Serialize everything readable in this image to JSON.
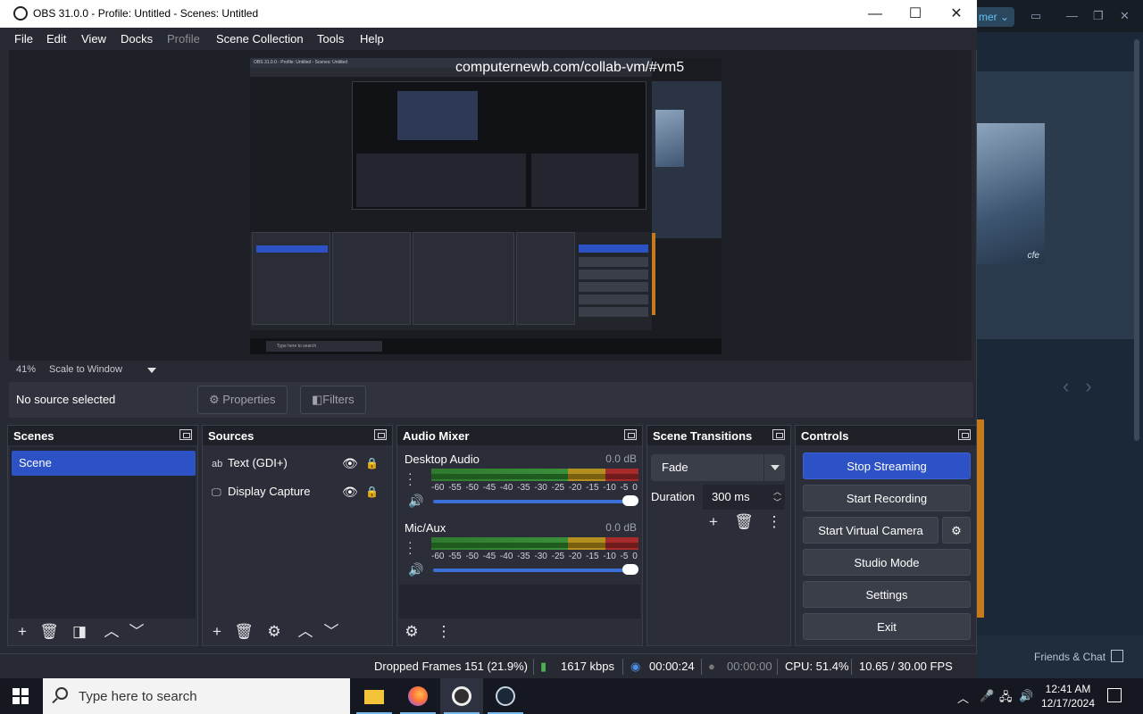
{
  "window": {
    "title": "OBS 31.0.0 - Profile: Untitled - Scenes: Untitled",
    "min": "—",
    "max": "☐",
    "close": "✕"
  },
  "menu": [
    "File",
    "Edit",
    "View",
    "Docks",
    "Profile",
    "Scene Collection",
    "Tools",
    "Help"
  ],
  "preview": {
    "url_overlay": "computernewb.com/collab-vm/#vm5",
    "nested_title": "OBS 31.0.0 - Profile: Untitled - Scenes: Untitled",
    "nested_search": "Type here to search",
    "zoom": "41%",
    "scale_mode": "Scale to Window"
  },
  "source_bar": {
    "no_selection": "No source selected",
    "properties": "Properties",
    "filters": "Filters"
  },
  "scenes": {
    "title": "Scenes",
    "items": [
      "Scene"
    ]
  },
  "sources": {
    "title": "Sources",
    "items": [
      {
        "label": "Text (GDI+)",
        "icon": "ab"
      },
      {
        "label": "Display Capture",
        "icon": "🖵"
      }
    ]
  },
  "mixer": {
    "title": "Audio Mixer",
    "channels": [
      {
        "name": "Desktop Audio",
        "db": "0.0 dB"
      },
      {
        "name": "Mic/Aux",
        "db": "0.0 dB"
      }
    ],
    "ticks": "-60 -55 -50 -45 -40 -35 -30 -25 -20 -15 -10 -5 0"
  },
  "transitions": {
    "title": "Scene Transitions",
    "selected": "Fade",
    "duration_label": "Duration",
    "duration_value": "300 ms"
  },
  "controls": {
    "title": "Controls",
    "stop_streaming": "Stop Streaming",
    "start_recording": "Start Recording",
    "start_virtual_camera": "Start Virtual Camera",
    "studio_mode": "Studio Mode",
    "settings": "Settings",
    "exit": "Exit"
  },
  "status": {
    "dropped_frames": "Dropped Frames 151 (21.9%)",
    "bitrate": "1617 kbps",
    "stream_time": "00:00:24",
    "rec_time": "00:00:00",
    "cpu": "CPU: 51.4%",
    "fps": "10.65 / 30.00 FPS"
  },
  "steam": {
    "user_pill": "mer",
    "thumb_label": "cfe",
    "friends": "Friends & Chat"
  },
  "taskbar": {
    "search_placeholder": "Type here to search",
    "time": "12:41 AM",
    "date": "12/17/2024"
  },
  "colors": {
    "accent": "#2c52c5",
    "panel": "#2b2e38",
    "window_bg": "#272a33"
  }
}
